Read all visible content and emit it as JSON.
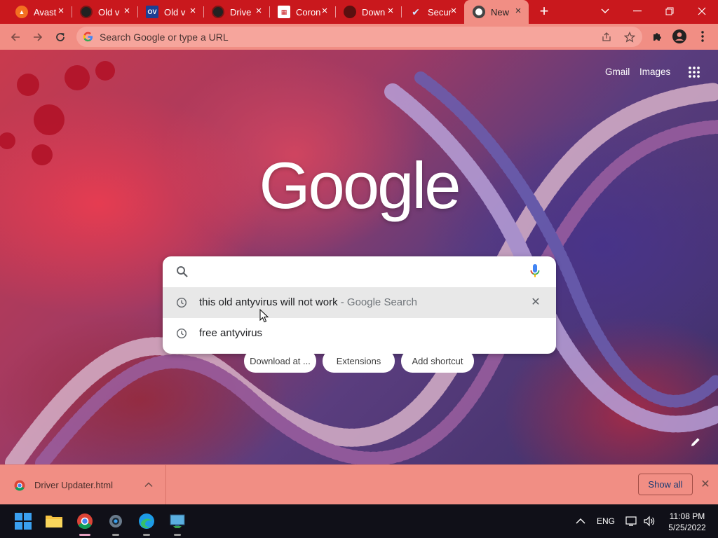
{
  "tabs": [
    {
      "title": "Avast",
      "favicon": "avast-icon",
      "color": "#f37021"
    },
    {
      "title": "Old v",
      "favicon": "globe-dark-icon",
      "color": "#222222"
    },
    {
      "title": "Old v",
      "favicon": "ov-icon",
      "color": "#1c3f94"
    },
    {
      "title": "Drive",
      "favicon": "globe-dark-icon",
      "color": "#222222"
    },
    {
      "title": "Coron",
      "favicon": "calendar-icon",
      "color": "#ffffff"
    },
    {
      "title": "Down",
      "favicon": "github-icon",
      "color": "#333333"
    },
    {
      "title": "Secur",
      "favicon": "check-icon",
      "color": "#1c4f94"
    },
    {
      "title": "New",
      "favicon": "chrome-icon",
      "color": "#444444",
      "active": true
    }
  ],
  "toolbar": {
    "omnibox_placeholder": "Search Google or type a URL"
  },
  "ntp": {
    "gmail": "Gmail",
    "images": "Images",
    "logo": "Google",
    "suggestions": [
      {
        "text": "this old antyvirus will not work",
        "suffix": " - Google Search"
      },
      {
        "text": "free antyvirus",
        "suffix": ""
      }
    ],
    "shortcuts": [
      "Download at ...",
      "Extensions",
      "Add shortcut"
    ]
  },
  "download_bar": {
    "filename": "Driver Updater.html",
    "show_all": "Show all"
  },
  "taskbar": {
    "language": "ENG",
    "time": "11:08 PM",
    "date": "5/25/2022"
  },
  "colors": {
    "tabstrip": "#c9181d",
    "toolbar": "#f18e84",
    "taskbar": "#101018"
  }
}
